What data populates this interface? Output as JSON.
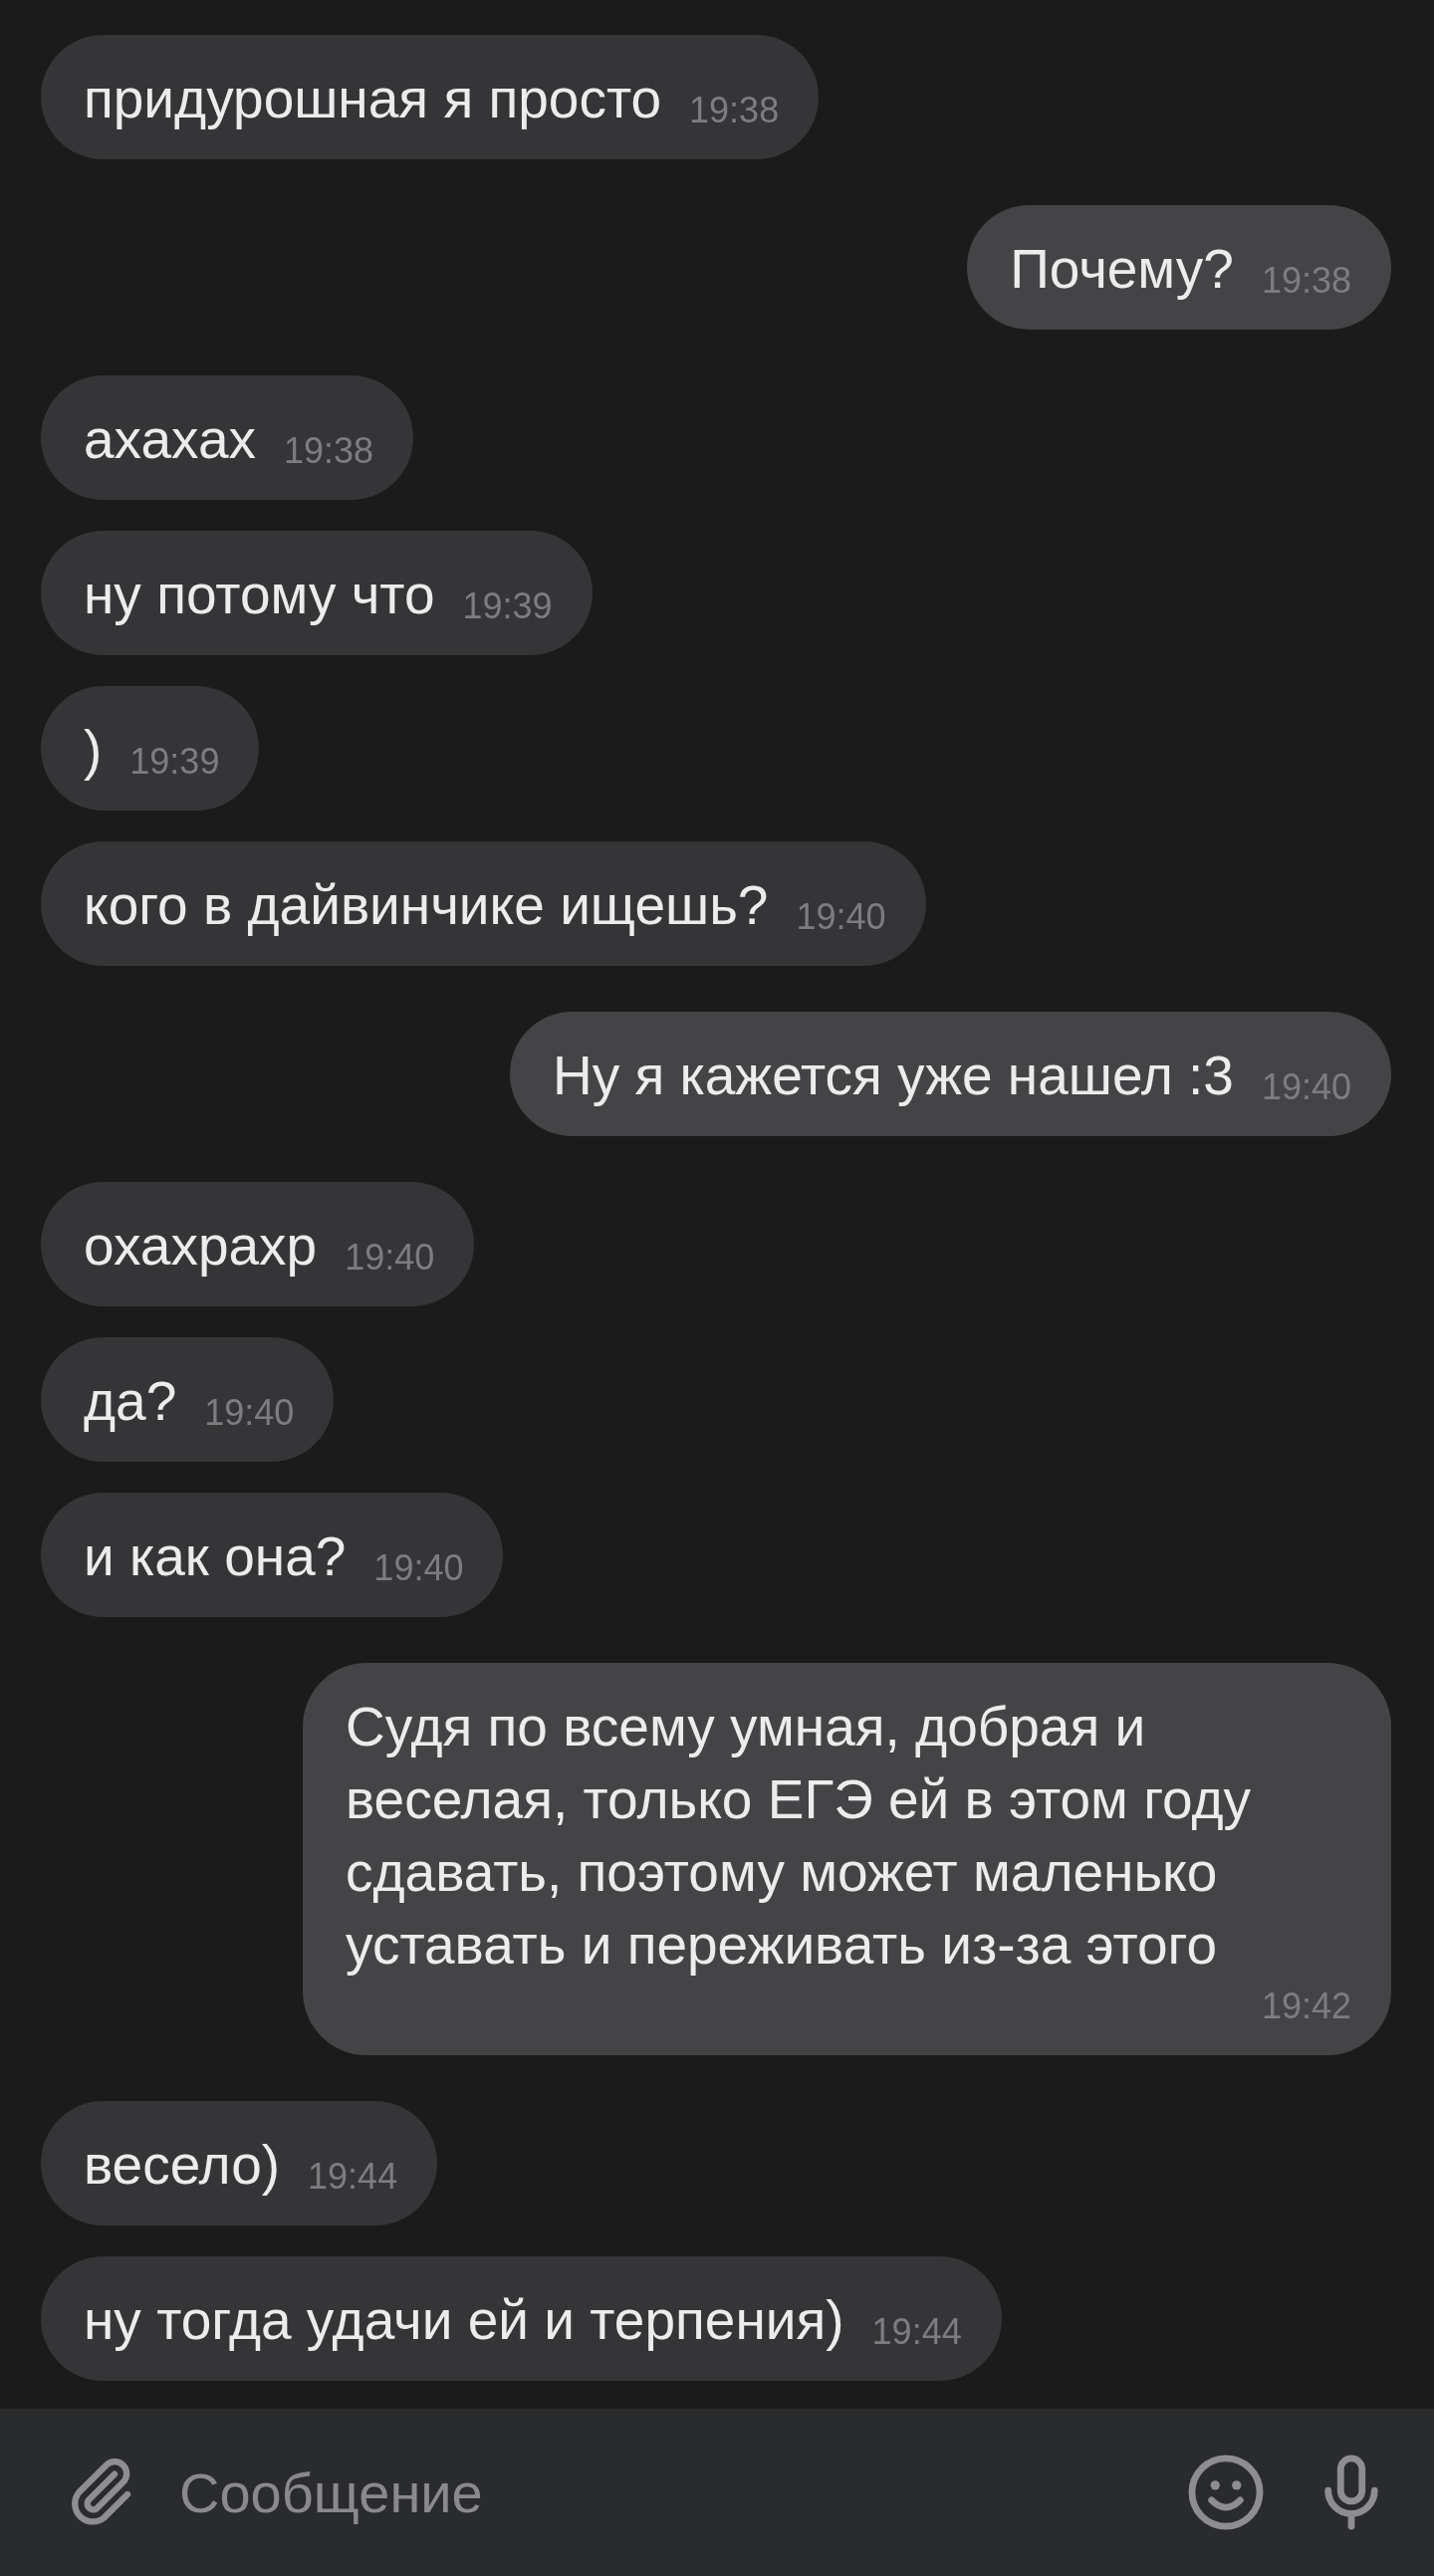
{
  "messages": [
    {
      "text": "придурошная я просто",
      "time": "19:38",
      "outgoing": false
    },
    {
      "text": "Почему?",
      "time": "19:38",
      "outgoing": true
    },
    {
      "text": "ахахах",
      "time": "19:38",
      "outgoing": false
    },
    {
      "text": "ну потому что",
      "time": "19:39",
      "outgoing": false
    },
    {
      "text": ")",
      "time": "19:39",
      "outgoing": false
    },
    {
      "text": "кого в дайвинчике ищешь?",
      "time": "19:40",
      "outgoing": false
    },
    {
      "text": "Ну я кажется уже нашел :3",
      "time": "19:40",
      "outgoing": true
    },
    {
      "text": "охахрахр",
      "time": "19:40",
      "outgoing": false
    },
    {
      "text": "да?",
      "time": "19:40",
      "outgoing": false
    },
    {
      "text": "и как она?",
      "time": "19:40",
      "outgoing": false
    },
    {
      "text": "Судя по всему умная, добрая и веселая, только ЕГЭ ей в этом году сдавать, поэтому может маленько уставать и переживать из-за этого",
      "time": "19:42",
      "outgoing": true
    },
    {
      "text": "весело)",
      "time": "19:44",
      "outgoing": false
    },
    {
      "text": "ну тогда удачи ей и терпения)",
      "time": "19:44",
      "outgoing": false
    }
  ],
  "composer": {
    "placeholder": "Сообщение"
  }
}
